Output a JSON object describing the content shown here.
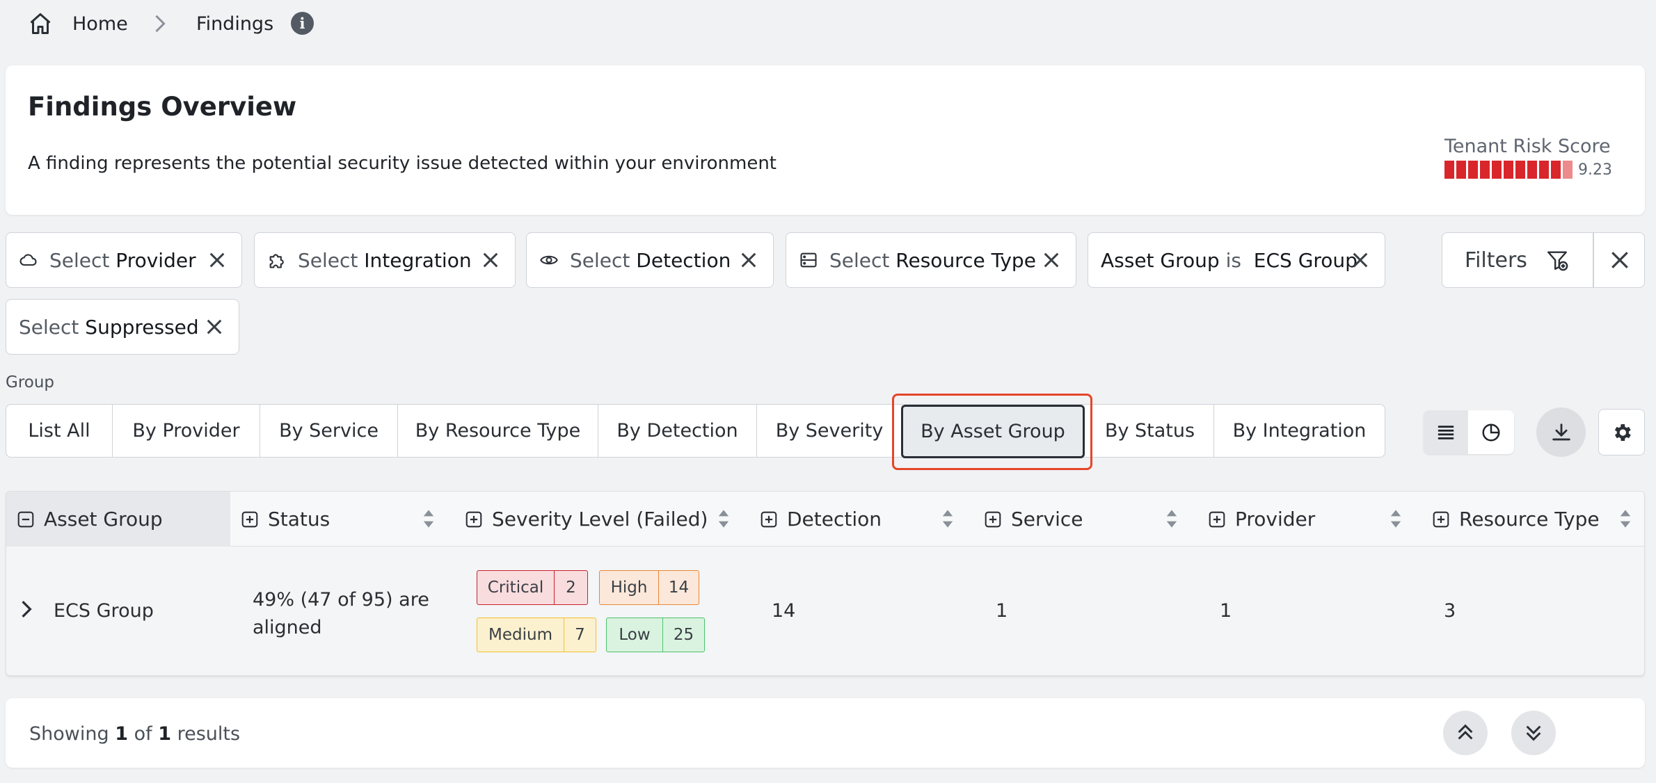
{
  "breadcrumb": {
    "home": "Home",
    "current": "Findings"
  },
  "overview": {
    "title": "Findings Overview",
    "description": "A finding represents the potential security issue detected within your environment",
    "risk_label": "Tenant Risk Score",
    "risk_value": "9.23",
    "risk_fraction": 0.923
  },
  "filters": {
    "provider": {
      "pre": "Select",
      "main": "Provider"
    },
    "integration": {
      "pre": "Select",
      "main": "Integration"
    },
    "detection": {
      "pre": "Select",
      "main": "Detection"
    },
    "resource_type": {
      "pre": "Select",
      "main": "Resource Type"
    },
    "asset_group": {
      "key": "Asset Group",
      "op": "is",
      "value": "ECS Group"
    },
    "suppressed": {
      "pre": "Select",
      "main": "Suppressed"
    },
    "filters_label": "Filters"
  },
  "group": {
    "label": "Group",
    "items": [
      "List All",
      "By Provider",
      "By Service",
      "By Resource Type",
      "By Detection",
      "By Severity",
      "By Asset Group",
      "By Status",
      "By Integration"
    ],
    "active": "By Asset Group"
  },
  "table": {
    "headers": [
      "Asset Group",
      "Status",
      "Severity Level (Failed)",
      "Detection",
      "Service",
      "Provider",
      "Resource Type"
    ],
    "rows": [
      {
        "asset_group": "ECS Group",
        "status_line1": "49% (47 of 95) are",
        "status_line2": "aligned",
        "severity": {
          "critical": {
            "label": "Critical",
            "count": "2"
          },
          "high": {
            "label": "High",
            "count": "14"
          },
          "medium": {
            "label": "Medium",
            "count": "7"
          },
          "low": {
            "label": "Low",
            "count": "25"
          }
        },
        "detection": "14",
        "service": "1",
        "provider": "1",
        "resource_type": "3"
      }
    ]
  },
  "footer": {
    "showing": "Showing",
    "count": "1",
    "of": "of",
    "total": "1",
    "results": "results"
  },
  "colors": {
    "accent_highlight": "#e5462a",
    "risk_red": "#d9262b",
    "critical": "#c8232c",
    "high": "#e8873a",
    "medium": "#f2c12e",
    "low": "#4cc36b"
  }
}
